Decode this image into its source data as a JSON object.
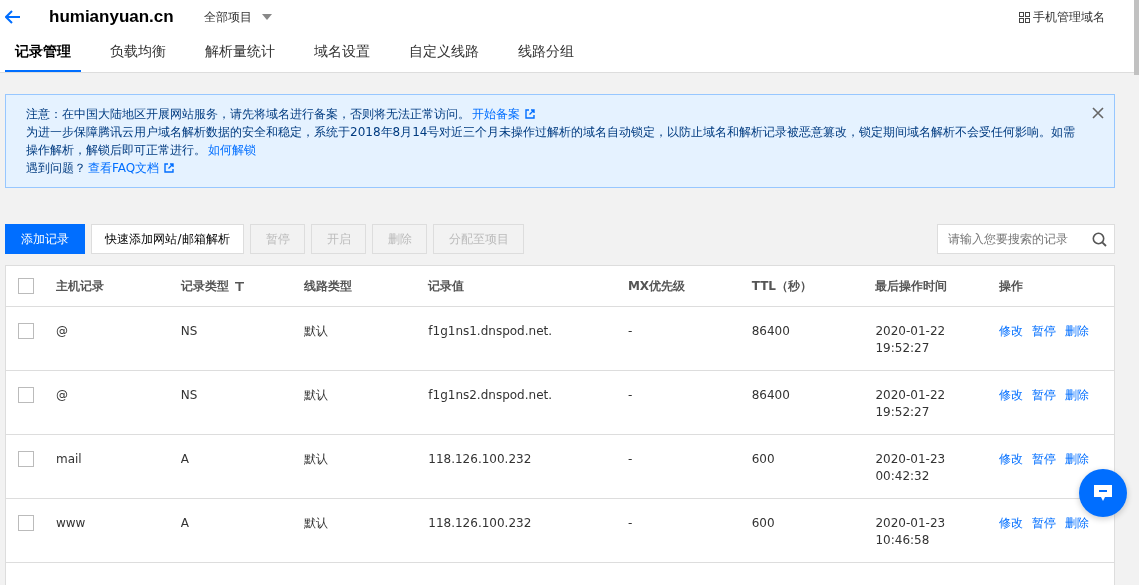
{
  "header": {
    "domain": "humianyuan.cn",
    "project": "全部项目",
    "mobile": "手机管理域名"
  },
  "tabs": [
    {
      "label": "记录管理",
      "selected": true
    },
    {
      "label": "负载均衡",
      "selected": false
    },
    {
      "label": "解析量统计",
      "selected": false
    },
    {
      "label": "域名设置",
      "selected": false
    },
    {
      "label": "自定义线路",
      "selected": false
    },
    {
      "label": "线路分组",
      "selected": false
    }
  ],
  "notice": {
    "lines": [
      {
        "text": "注意：在中国大陆地区开展网站服务，请先将域名进行备案，否则将无法正常访问。",
        "link": "开始备案",
        "external": true
      },
      {
        "text": "为进一步保障腾讯云用户域名解析数据的安全和稳定，系统于2018年8月14号对近三个月未操作过解析的域名自动锁定，以防止域名和解析记录被恶意篡改，锁定期间域名解析不会受任何影响。如需操作解析，解锁后即可正常进行。",
        "link": "如何解锁",
        "external": false
      },
      {
        "text": "遇到问题？",
        "link": "查看FAQ文档",
        "external": true
      }
    ]
  },
  "toolbar": {
    "buttons": [
      {
        "label": "添加记录",
        "kind": "primary",
        "disabled": false
      },
      {
        "label": "快速添加网站/邮箱解析",
        "kind": "default",
        "disabled": false
      },
      {
        "label": "暂停",
        "kind": "default",
        "disabled": true
      },
      {
        "label": "开启",
        "kind": "default",
        "disabled": true
      },
      {
        "label": "删除",
        "kind": "default",
        "disabled": true
      },
      {
        "label": "分配至项目",
        "kind": "default",
        "disabled": true
      }
    ],
    "search": {
      "placeholder": "请输入您要搜索的记录"
    }
  },
  "table": {
    "all_checked": false,
    "columns": [
      {
        "label": "主机记录",
        "filter": false
      },
      {
        "label": "记录类型",
        "filter": true
      },
      {
        "label": "线路类型",
        "filter": false
      },
      {
        "label": "记录值",
        "filter": false
      },
      {
        "label": "MX优先级",
        "filter": false
      },
      {
        "label": "TTL（秒）",
        "filter": false
      },
      {
        "label": "最后操作时间",
        "filter": false
      },
      {
        "label": "操作",
        "filter": false
      }
    ],
    "rows": [
      {
        "checked": false,
        "host": "@",
        "type": "NS",
        "line": "默认",
        "value": "f1g1ns1.dnspod.net.",
        "mx": "-",
        "ttl": "86400",
        "date": "2020-01-22",
        "time": "19:52:27",
        "actions": [
          "修改",
          "暂停",
          "删除"
        ]
      },
      {
        "checked": false,
        "host": "@",
        "type": "NS",
        "line": "默认",
        "value": "f1g1ns2.dnspod.net.",
        "mx": "-",
        "ttl": "86400",
        "date": "2020-01-22",
        "time": "19:52:27",
        "actions": [
          "修改",
          "暂停",
          "删除"
        ]
      },
      {
        "checked": false,
        "host": "mail",
        "type": "A",
        "line": "默认",
        "value": "118.126.100.232",
        "mx": "-",
        "ttl": "600",
        "date": "2020-01-23",
        "time": "00:42:32",
        "actions": [
          "修改",
          "暂停",
          "删除"
        ]
      },
      {
        "checked": false,
        "host": "www",
        "type": "A",
        "line": "默认",
        "value": "118.126.100.232",
        "mx": "-",
        "ttl": "600",
        "date": "2020-01-23",
        "time": "10:46:58",
        "actions": [
          "修改",
          "暂停",
          "删除"
        ]
      }
    ]
  }
}
